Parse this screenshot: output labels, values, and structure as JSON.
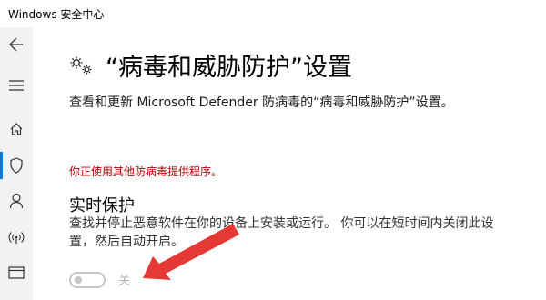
{
  "window": {
    "title": "Windows 安全中心"
  },
  "sidebar": {
    "items": [
      {
        "icon": "back-arrow-icon"
      },
      {
        "icon": "hamburger-menu-icon"
      },
      {
        "icon": "home-icon"
      },
      {
        "icon": "shield-icon",
        "active": true
      },
      {
        "icon": "person-icon"
      },
      {
        "icon": "wireless-signal-icon"
      },
      {
        "icon": "app-browser-icon"
      }
    ],
    "accent_color": "#0078d4"
  },
  "page": {
    "title": "“病毒和威胁防护”设置",
    "title_icon": "gear-icon",
    "description": "查看和更新 Microsoft Defender 防病毒的“病毒和威胁防护”设置。",
    "warning": "你正使用其他防病毒提供程序。",
    "warning_color": "#b00000"
  },
  "realtime": {
    "title": "实时保护",
    "description": "查找并停止恶意软件在你的设备上安装或运行。 你可以在短时间内关闭此设置，然后自动开启。",
    "toggle_state": "off",
    "toggle_label": "关"
  },
  "annotation": {
    "icon": "red-arrow-icon",
    "color": "#e53935"
  }
}
